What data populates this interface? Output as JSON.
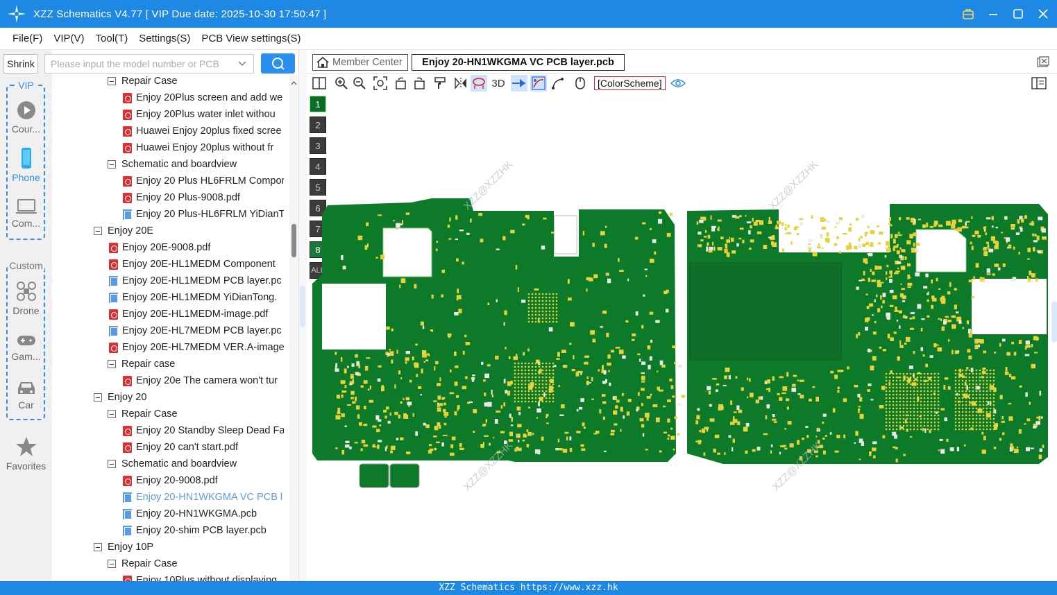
{
  "window": {
    "title": "XZZ Schematics V4.77 [ VIP Due date: 2025-10-30 17:50:47 ]"
  },
  "menu": [
    "File(F)",
    "VIP(V)",
    "Tool(T)",
    "Settings(S)",
    "PCB View settings(S)"
  ],
  "search": {
    "shrink_label": "Shrink",
    "placeholder": "Please input the model number or PCB"
  },
  "left_nav": {
    "vip_label": "VIP",
    "custom_label": "Custom",
    "items": [
      {
        "label": "Cour...",
        "icon": "play-icon"
      },
      {
        "label": "Phone",
        "icon": "phone-icon",
        "active": true
      },
      {
        "label": "Com...",
        "icon": "laptop-icon"
      },
      {
        "label": "Drone",
        "icon": "drone-icon"
      },
      {
        "label": "Gam...",
        "icon": "gamepad-icon"
      },
      {
        "label": "Car",
        "icon": "car-icon"
      },
      {
        "label": "Favorites",
        "icon": "star-icon"
      }
    ]
  },
  "tree": [
    {
      "level": 1,
      "type": "folder",
      "label": "Repair Case"
    },
    {
      "level": 2,
      "type": "pdf",
      "label": "Enjoy 20Plus screen and add we"
    },
    {
      "level": 2,
      "type": "pdf",
      "label": "Enjoy 20Plus water inlet withou"
    },
    {
      "level": 2,
      "type": "pdf",
      "label": "Huawei Enjoy 20plus fixed scree"
    },
    {
      "level": 2,
      "type": "pdf",
      "label": "Huawei Enjoy 20plus without fr"
    },
    {
      "level": 1,
      "type": "folder",
      "label": "Schematic and boardview"
    },
    {
      "level": 2,
      "type": "pdf",
      "label": "Enjoy 20 Plus HL6FRLM Compor"
    },
    {
      "level": 2,
      "type": "pdf",
      "label": "Enjoy 20 Plus-9008.pdf"
    },
    {
      "level": 2,
      "type": "pcb",
      "label": "Enjoy 20 Plus-HL6FRLM YiDianT"
    },
    {
      "level": 0,
      "type": "folder",
      "label": "Enjoy 20E"
    },
    {
      "level": 1,
      "type": "pdf",
      "label": "Enjoy 20E-9008.pdf"
    },
    {
      "level": 1,
      "type": "pdf",
      "label": "Enjoy 20E-HL1MEDM Component"
    },
    {
      "level": 1,
      "type": "pcb",
      "label": "Enjoy 20E-HL1MEDM PCB layer.pc"
    },
    {
      "level": 1,
      "type": "pcb",
      "label": "Enjoy 20E-HL1MEDM YiDianTong."
    },
    {
      "level": 1,
      "type": "pdf",
      "label": "Enjoy 20E-HL1MEDM-image.pdf"
    },
    {
      "level": 1,
      "type": "pcb",
      "label": "Enjoy 20E-HL7MEDM PCB layer.pc"
    },
    {
      "level": 1,
      "type": "pdf",
      "label": "Enjoy 20E-HL7MEDM VER.A-image"
    },
    {
      "level": 1,
      "type": "folder",
      "label": "Repair case"
    },
    {
      "level": 2,
      "type": "pdf",
      "label": "Enjoy 20e The camera won't tur"
    },
    {
      "level": 0,
      "type": "folder",
      "label": "Enjoy 20"
    },
    {
      "level": 1,
      "type": "folder",
      "label": "Repair Case"
    },
    {
      "level": 2,
      "type": "pdf",
      "label": "Enjoy 20 Standby Sleep Dead Fa"
    },
    {
      "level": 2,
      "type": "pdf",
      "label": "Enjoy 20 can't start.pdf"
    },
    {
      "level": 1,
      "type": "folder",
      "label": "Schematic and boardview"
    },
    {
      "level": 2,
      "type": "pdf",
      "label": "Enjoy 20-9008.pdf"
    },
    {
      "level": 2,
      "type": "pcb",
      "label": "Enjoy 20-HN1WKGMA VC PCB l",
      "selected": true
    },
    {
      "level": 2,
      "type": "pcb",
      "label": "Enjoy 20-HN1WKGMA.pcb"
    },
    {
      "level": 2,
      "type": "pcb",
      "label": "Enjoy 20-shim PCB layer.pcb"
    },
    {
      "level": 0,
      "type": "folder",
      "label": "Enjoy 10P"
    },
    {
      "level": 1,
      "type": "folder",
      "label": "Repair Case"
    },
    {
      "level": 2,
      "type": "pdf",
      "label": "Enjoy 10Plus without displaying"
    }
  ],
  "tabs": {
    "member_center": "Member Center",
    "active": "Enjoy 20-HN1WKGMA VC PCB layer.pcb"
  },
  "toolbar": {
    "label_3d": "3D",
    "color_scheme": "[ColorScheme]"
  },
  "layers": [
    "1",
    "2",
    "3",
    "4",
    "5",
    "6",
    "7",
    "8",
    "ALL"
  ],
  "watermark": "XZZ@XZZHK",
  "status": "XZZ Schematics https://www.xzz.hk",
  "colors": {
    "accent": "#1e88e5",
    "pcb_green": "#0d7a2a",
    "pad_yellow": "#e8d23a"
  }
}
